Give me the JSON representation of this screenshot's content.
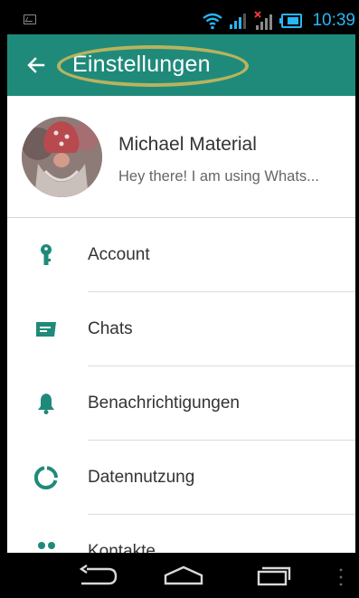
{
  "status_bar": {
    "time": "10:39",
    "icons": [
      "gallery-icon",
      "wifi-icon",
      "signal-icon",
      "signal-no-data-icon",
      "battery-icon"
    ]
  },
  "app_bar": {
    "title": "Einstellungen",
    "back_icon": "arrow-left-icon",
    "background": "#1f8a7a"
  },
  "profile": {
    "name": "Michael Material",
    "status": "Hey there! I am using Whats..."
  },
  "menu": {
    "items": [
      {
        "label": "Account",
        "icon": "key-icon"
      },
      {
        "label": "Chats",
        "icon": "chat-icon"
      },
      {
        "label": "Benachrichtigungen",
        "icon": "bell-icon"
      },
      {
        "label": "Datennutzung",
        "icon": "data-usage-icon"
      },
      {
        "label": "Kontakte",
        "icon": "contacts-icon"
      }
    ]
  },
  "nav_bar": {
    "buttons": [
      "back-icon",
      "home-icon",
      "recents-icon",
      "menu-dots-icon"
    ]
  },
  "colors": {
    "accent": "#1f8a7a",
    "icon": "#1f8a7a",
    "highlight_oval": "#b8b35f",
    "clock": "#29b6f6"
  }
}
